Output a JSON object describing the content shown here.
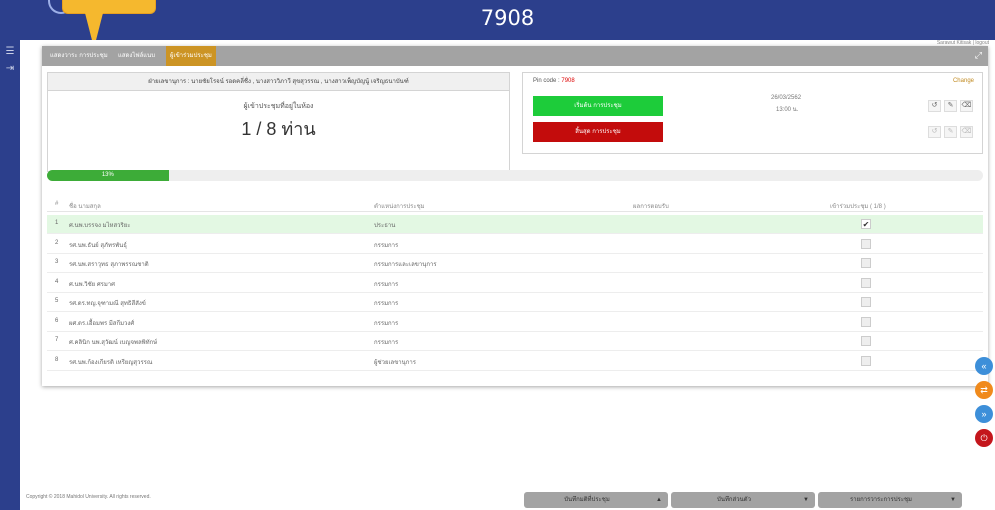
{
  "header": {
    "pin_title": "7908"
  },
  "user_line": "Sarawut Kitisak | logout",
  "tabs": [
    {
      "label": "แสดงวาระ การประชุม"
    },
    {
      "label": "แสดงไฟล์แนบ"
    },
    {
      "label": "ผู้เข้าร่วมประชุม"
    }
  ],
  "secretaries": "ฝ่ายเลขานุการ : นายชัยโรจน์ รอดคลี่ชื่ง , นางสาววิภาวี สุขสุวรรณ , นางสาวเพ็ญบัญนู้ เจริญธนาบันฑ์",
  "attendance": {
    "label": "ผู้เข้าประชุมที่อยู่ในห้อง",
    "count": "1 / 8 ท่าน"
  },
  "pin": {
    "label": "Pin code :",
    "value": "7908",
    "change": "Change"
  },
  "meeting": {
    "start_label": "เริ่มต้น การประชุม",
    "end_label": "สิ้นสุด การประชุม",
    "date": "26/03/2562",
    "time": "13:00 น."
  },
  "progress": {
    "label": "13%",
    "value": 0.13
  },
  "table": {
    "headers": [
      "#",
      "ชื่อ นามสกุล",
      "ตำแหน่งการประชุม",
      "ผลการตอบรับ",
      "เข้าร่วมประชุม ( 1/8 )"
    ],
    "rows": [
      {
        "no": "1",
        "name": "ศ.นพ.บรรจง มไหสวริยะ",
        "position": "ประธาน",
        "checked": true
      },
      {
        "no": "2",
        "name": "รศ.นพ.ธันย์ สุภัทรพันธุ์",
        "position": "กรรมการ",
        "checked": false
      },
      {
        "no": "3",
        "name": "รศ.นพ.สราวุทธ สุภาพรรณชาติ",
        "position": "กรรมการและเลขานุการ",
        "checked": false
      },
      {
        "no": "4",
        "name": "ศ.นพ.วิชัย ศรมาศ",
        "position": "กรรมการ",
        "checked": false
      },
      {
        "no": "5",
        "name": "รศ.ดร.ทญ.จุฑามณี สุทธิสีสังข์",
        "position": "กรรมการ",
        "checked": false
      },
      {
        "no": "6",
        "name": "ผศ.ดร.เอื้อมพร มีสกีมวงศ์",
        "position": "กรรมการ",
        "checked": false
      },
      {
        "no": "7",
        "name": "ศ.คลินิก นพ.สุวัฒน์ เบญจพลพิทักษ์",
        "position": "กรรมการ",
        "checked": false
      },
      {
        "no": "8",
        "name": "รศ.นพ.ก้องเกียรติ เหรียญสุวรรณ",
        "position": "ผู้ช่วยเลขานุการ",
        "checked": false
      }
    ]
  },
  "footer": {
    "copyright": "Copyright © 2018 Mahidol University. All rights reserved.",
    "dropdowns": [
      "บันทึกมติที่ประชุม",
      "บันทึกส่วนตัว",
      "รายการวาระการประชุม"
    ]
  }
}
